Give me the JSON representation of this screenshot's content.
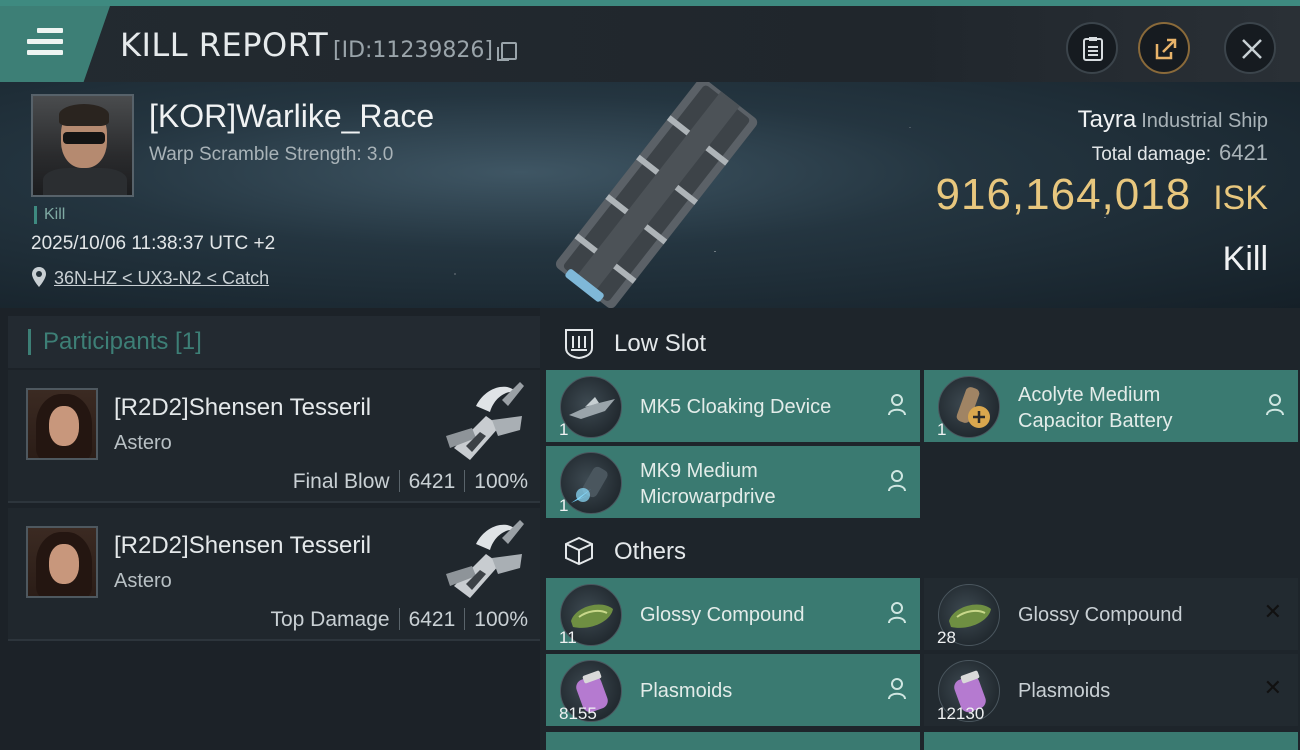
{
  "header": {
    "title": "KILL REPORT",
    "report_id": "[ID:11239826]",
    "icons": [
      "menu-icon",
      "copy-icon",
      "clipboard-icon",
      "share-icon",
      "close-icon"
    ]
  },
  "victim": {
    "name": "[KOR]Warlike_Race",
    "warp_scramble": "Warp Scramble Strength: 3.0",
    "tag": "Kill",
    "datetime": "2025/10/06 11:38:37 UTC +2",
    "location": "36N-HZ < UX3-N2 < Catch",
    "ship_name": "Tayra",
    "ship_class": "Industrial Ship",
    "total_damage_label": "Total damage:",
    "total_damage": "6421",
    "isk_value": "916,164,018",
    "isk_unit": "ISK",
    "result": "Kill"
  },
  "participants": {
    "header": "Participants [1]",
    "list": [
      {
        "name": "[R2D2]Shensen Tesseril",
        "ship": "Astero",
        "role": "Final Blow",
        "damage": "6421",
        "percent": "100%"
      },
      {
        "name": "[R2D2]Shensen Tesseril",
        "ship": "Astero",
        "role": "Top Damage",
        "damage": "6421",
        "percent": "100%"
      }
    ]
  },
  "modules": {
    "low_slot_label": "Low Slot",
    "others_label": "Others",
    "low_slot": [
      {
        "line1": "MK5 Cloaking Device",
        "line2": "",
        "qty": "1",
        "status": "destroyed"
      },
      {
        "line1": "Acolyte Medium",
        "line2": "Capacitor Battery",
        "qty": "1",
        "status": "destroyed"
      },
      {
        "line1": "MK9 Medium",
        "line2": "Microwarpdrive",
        "qty": "1",
        "status": "destroyed"
      }
    ],
    "others": [
      {
        "line1": "Glossy Compound",
        "qty": "11",
        "status": "destroyed"
      },
      {
        "line1": "Glossy Compound",
        "qty": "28",
        "status": "dropped"
      },
      {
        "line1": "Plasmoids",
        "qty": "8155",
        "status": "destroyed"
      },
      {
        "line1": "Plasmoids",
        "qty": "12130",
        "status": "dropped"
      }
    ]
  },
  "colors": {
    "accent": "#3d7f76",
    "isk": "#e8c77e",
    "background": "#1b2026"
  }
}
